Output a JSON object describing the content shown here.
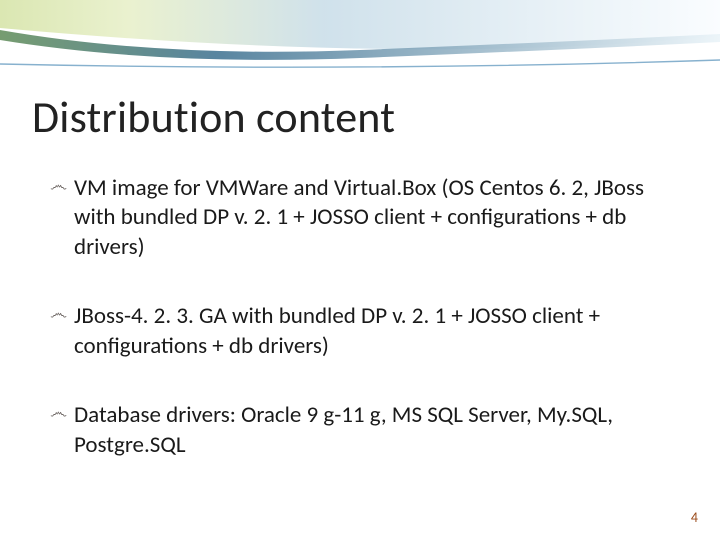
{
  "title": "Distribution content",
  "bullets": [
    "VM image for VMWare and Virtual.Box (OS Centos 6. 2, JBoss with bundled DP v. 2. 1 + JOSSO client + configurations + db drivers)",
    "JBoss-4. 2. 3. GA with bundled DP v. 2. 1 + JOSSO client + configurations + db drivers)",
    "Database drivers: Oracle 9 g-11 g, MS SQL Server, My.SQL, Postgre.SQL"
  ],
  "bullet_glyph": "෴",
  "page_number": "4",
  "accent": {
    "line": "#7aa9c9",
    "grad_a": "#bdd373",
    "grad_b": "#6fa8c7",
    "grad_c": "#f5f9e8"
  }
}
